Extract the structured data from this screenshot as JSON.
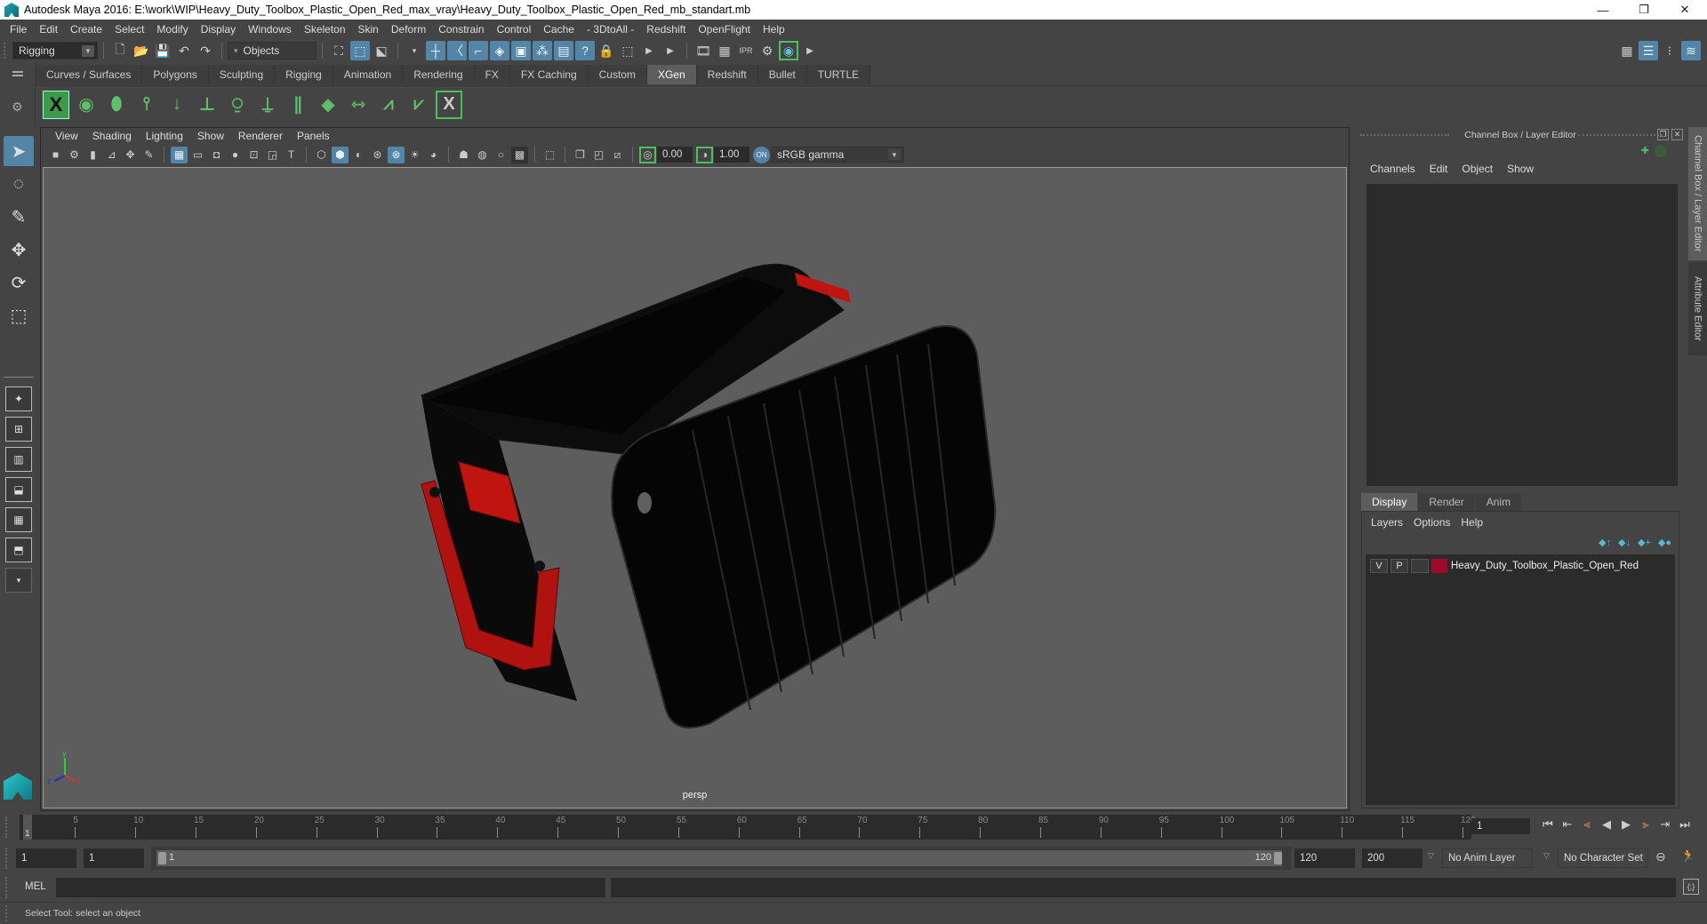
{
  "window": {
    "title": "Autodesk Maya 2016: E:\\work\\WIP\\Heavy_Duty_Toolbox_Plastic_Open_Red_max_vray\\Heavy_Duty_Toolbox_Plastic_Open_Red_mb_standart.mb",
    "minimize": "—",
    "restore": "❐",
    "close": "✕"
  },
  "menubar": [
    "File",
    "Edit",
    "Create",
    "Select",
    "Modify",
    "Display",
    "Windows",
    "Skeleton",
    "Skin",
    "Deform",
    "Constrain",
    "Control",
    "Cache",
    "- 3DtoAll -",
    "Redshift",
    "OpenFlight",
    "Help"
  ],
  "statusline": {
    "menuset": "Rigging",
    "selection_mode": "Objects"
  },
  "shelf": {
    "tabs": [
      "Curves / Surfaces",
      "Polygons",
      "Sculpting",
      "Rigging",
      "Animation",
      "Rendering",
      "FX",
      "FX Caching",
      "Custom",
      "XGen",
      "Redshift",
      "Bullet",
      "TURTLE"
    ],
    "active_tab": "XGen",
    "icons": [
      "xgen-editor",
      "xgen-preview",
      "xgen-clear-preview",
      "xgen-add-guides",
      "xgen-sculpt-guides",
      "xgen-add-guide",
      "xgen-guide-visibility",
      "xgen-lock-guides",
      "xgen-guide-shape",
      "xgen-density-map",
      "xgen-rebuild",
      "xgen-select-guides",
      "xgen-guide-cvs",
      "xgen-create-description"
    ]
  },
  "viewport": {
    "menu": [
      "View",
      "Shading",
      "Lighting",
      "Show",
      "Renderer",
      "Panels"
    ],
    "exposure": "0.00",
    "gamma": "1.00",
    "color_space": "sRGB gamma",
    "camera_label": "persp"
  },
  "channel_box": {
    "title": "Channel Box / Layer Editor",
    "menu": [
      "Channels",
      "Edit",
      "Object",
      "Show"
    ]
  },
  "layer_editor": {
    "tabs": [
      "Display",
      "Render",
      "Anim"
    ],
    "active_tab": "Display",
    "menu": [
      "Layers",
      "Options",
      "Help"
    ],
    "layers": [
      {
        "visible": "V",
        "playback": "P",
        "name": "Heavy_Duty_Toolbox_Plastic_Open_Red",
        "color": "#a3082a"
      }
    ]
  },
  "side_tabs": [
    "Channel Box / Layer Editor",
    "Attribute Editor"
  ],
  "timeline": {
    "start": 1,
    "end": 120,
    "ticks": [
      5,
      10,
      15,
      20,
      25,
      30,
      35,
      40,
      45,
      50,
      55,
      60,
      65,
      70,
      75,
      80,
      85,
      90,
      95,
      100,
      105,
      110,
      115,
      120
    ],
    "current_frame_marker": "1",
    "current_frame": "1"
  },
  "range": {
    "start_time": "1",
    "playback_start": "1",
    "slider_start": "1",
    "slider_end": "120",
    "playback_end": "120",
    "end_time": "200",
    "anim_layer": "No Anim Layer",
    "character_set": "No Character Set"
  },
  "command_line": {
    "label": "MEL"
  },
  "help_line": "Select Tool: select an object",
  "colors": {
    "accent": "#5285a6",
    "shelf_green": "#5fbf6a",
    "layer_red": "#a3082a",
    "playback_orange": "#d9824a"
  }
}
